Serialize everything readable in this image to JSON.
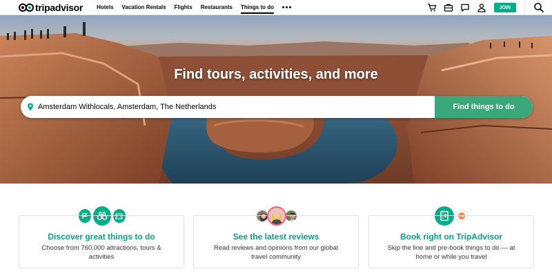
{
  "brand": {
    "name": "tripadvisor"
  },
  "nav": {
    "items": [
      {
        "label": "Hotels"
      },
      {
        "label": "Vacation Rentals"
      },
      {
        "label": "Flights"
      },
      {
        "label": "Restaurants"
      },
      {
        "label": "Things to do",
        "active": true
      }
    ],
    "more_icon": "more-dots-icon"
  },
  "header_actions": {
    "icons": [
      "shopping-cart-icon",
      "trips-suitcase-icon",
      "messages-icon",
      "profile-icon",
      "search-icon"
    ],
    "join_label": "JOIN"
  },
  "hero": {
    "title": "Find tours, activities, and more",
    "search_value": "Amsterdam Withlocals, Amsterdam, The Netherlands",
    "search_icon": "location-pin-icon",
    "button_label": "Find things to do"
  },
  "features": [
    {
      "icons": [
        "flag-icon",
        "binoculars-icon",
        "ticket-icon"
      ],
      "title": "Discover great things to do",
      "description": "Choose from 760,000 attractions, tours & activities"
    },
    {
      "icons": [
        "reviewer-avatar-1",
        "reviewer-avatar-2",
        "reviewer-avatar-3"
      ],
      "title": "See the latest reviews",
      "description": "Read reviews and opinions from our global travel community"
    },
    {
      "icons": [
        "booking-ticket-icon",
        "tripadvisor-badge-icon"
      ],
      "title": "Book right on TripAdvisor",
      "description": "Skip the line and pre-book things to do — at home or while you travel"
    }
  ],
  "colors": {
    "brand_green": "#00af87",
    "button_green": "#3aa87b",
    "title_green": "#00a680"
  }
}
